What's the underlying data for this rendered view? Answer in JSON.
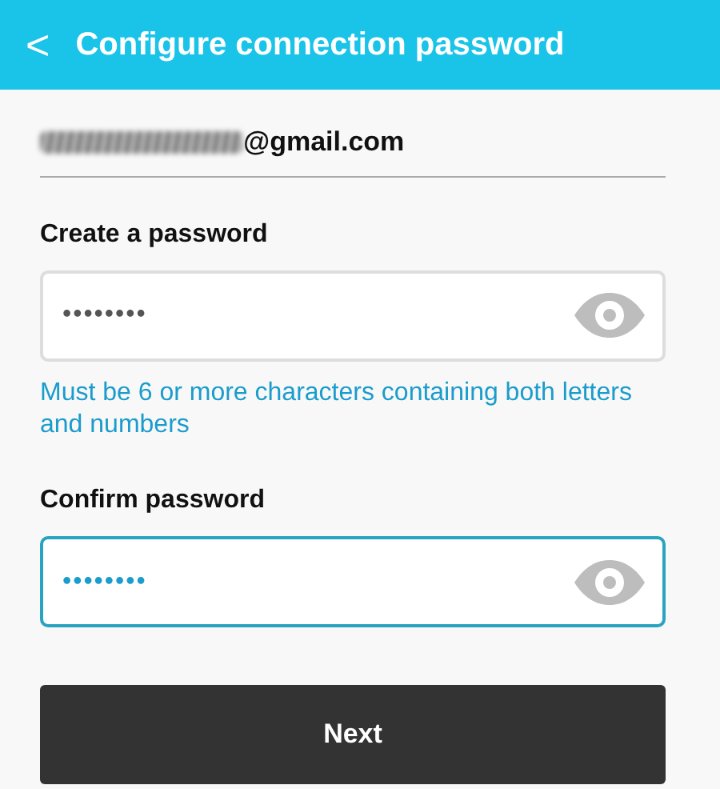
{
  "header": {
    "back_icon": "<",
    "title": "Configure connection password"
  },
  "account": {
    "email_visible": "@gmail.com",
    "redacted": true
  },
  "fields": [
    {
      "label": "Create a password",
      "value": "••••••••",
      "focused": false,
      "hint": "Must be 6 or more characters containing both letters and numbers"
    },
    {
      "label": "Confirm password",
      "value": "••••••••",
      "focused": true
    }
  ],
  "button": "Next"
}
